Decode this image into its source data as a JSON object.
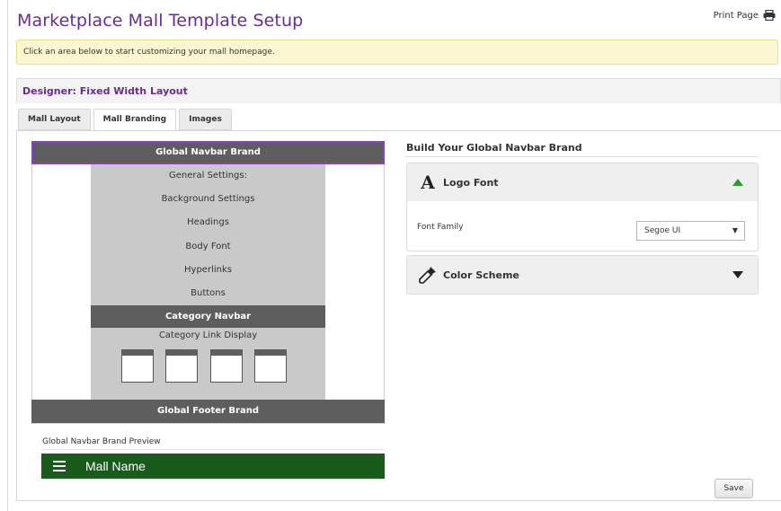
{
  "page": {
    "title": "Marketplace Mall Template Setup",
    "print_label": "Print Page",
    "notice": "Click an area below to start customizing your mall homepage."
  },
  "designer": {
    "heading": "Designer: Fixed Width Layout",
    "tabs": [
      {
        "label": "Mall Layout",
        "active": false
      },
      {
        "label": "Mall Branding",
        "active": true
      },
      {
        "label": "Images",
        "active": false
      }
    ]
  },
  "layout_diagram": {
    "global_navbar": "Global Navbar Brand",
    "settings": [
      "General Settings:",
      "Background Settings",
      "Headings",
      "Body Font",
      "Hyperlinks",
      "Buttons"
    ],
    "category_navbar": "Category Navbar",
    "category_link_display": "Category Link Display",
    "global_footer": "Global Footer Brand"
  },
  "preview": {
    "label": "Global Navbar Brand Preview",
    "mall_name": "Mall Name",
    "bar_color": "#1a5b1d"
  },
  "builder": {
    "title": "Build Your Global Navbar Brand",
    "logo_font": {
      "title": "Logo Font",
      "icon": "font-icon",
      "expanded": true,
      "font_family_label": "Font Family",
      "font_family_value": "Segoe UI"
    },
    "color_scheme": {
      "title": "Color Scheme",
      "icon": "eyedropper-icon",
      "expanded": false
    }
  },
  "actions": {
    "save_label": "Save"
  },
  "colors": {
    "accent_purple": "#6b2c91",
    "selection_border": "#8a3ec9",
    "expand_caret_green": "#2f9a2f"
  }
}
